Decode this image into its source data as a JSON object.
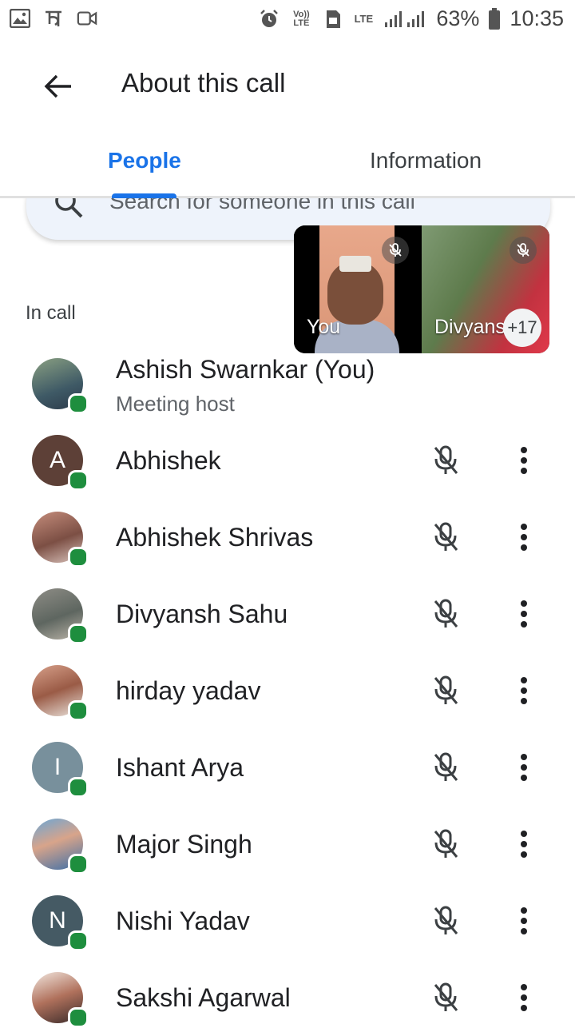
{
  "status_bar": {
    "battery": "63%",
    "time": "10:35",
    "icons": [
      "gallery-icon",
      "paytm-icon",
      "video-icon",
      "alarm-icon",
      "volte-icon",
      "sim-icon",
      "lte-icon",
      "signal-icon",
      "battery-icon"
    ],
    "volte_label": "Vo)) LTE",
    "lte_label": "LTE"
  },
  "topbar": {
    "title": "About this call"
  },
  "tabs": [
    {
      "label": "People",
      "active": true
    },
    {
      "label": "Information",
      "active": false
    }
  ],
  "search": {
    "placeholder": "Search for someone in this call"
  },
  "video": {
    "tiles": [
      {
        "label": "You"
      },
      {
        "label": "Divyansh"
      }
    ],
    "more_count": "+17"
  },
  "section": {
    "in_call_label": "In call"
  },
  "participants": [
    {
      "name": "Ashish Swarnkar (You)",
      "subtitle": "Meeting host",
      "initial": ""
    },
    {
      "name": "Abhishek",
      "initial": "A",
      "color": "#5d4037"
    },
    {
      "name": "Abhishek Shrivas",
      "initial": ""
    },
    {
      "name": "Divyansh Sahu",
      "initial": ""
    },
    {
      "name": "hirday yadav",
      "initial": ""
    },
    {
      "name": "Ishant Arya",
      "initial": "I",
      "color": "#78909c"
    },
    {
      "name": "Major Singh",
      "initial": ""
    },
    {
      "name": "Nishi Yadav",
      "initial": "N",
      "color": "#455a64"
    },
    {
      "name": "Sakshi Agarwal",
      "initial": ""
    }
  ],
  "colors": {
    "accent": "#1a73e8",
    "online": "#1e8e3e"
  }
}
